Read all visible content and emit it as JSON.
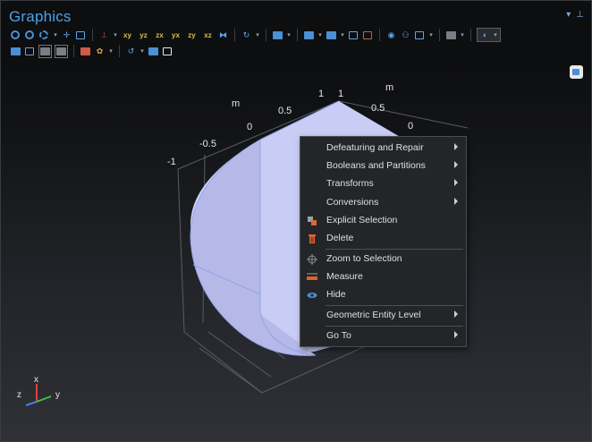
{
  "panel": {
    "title": "Graphics",
    "pin_glyph": "▾",
    "dock_glyph": "⊥"
  },
  "toolbar": {
    "row1_axis_buttons": [
      "xy",
      "yz",
      "zx",
      "yx",
      "zy",
      "xz"
    ],
    "dropdown_glyph": "▾"
  },
  "axes": {
    "unit_left": "m",
    "unit_right": "m",
    "ticks_left": [
      "-1",
      "-0.5",
      "0",
      "0.5",
      "1"
    ],
    "ticks_right": [
      "1",
      "0.5",
      "0"
    ],
    "triad": {
      "x": "x",
      "y": "y",
      "z": "z"
    }
  },
  "context_menu": {
    "items": [
      {
        "label": "Defeaturing and Repair",
        "submenu": true
      },
      {
        "label": "Booleans and Partitions",
        "submenu": true
      },
      {
        "label": "Transforms",
        "submenu": true
      },
      {
        "label": "Conversions",
        "submenu": true
      },
      {
        "label": "Explicit Selection",
        "icon": "explicit-selection-icon"
      },
      {
        "label": "Delete",
        "icon": "delete-icon"
      },
      {
        "label": "Zoom to Selection",
        "icon": "zoom-to-selection-icon"
      },
      {
        "label": "Measure",
        "icon": "measure-icon"
      },
      {
        "label": "Hide",
        "icon": "hide-eye-icon"
      },
      {
        "label": "Geometric Entity Level",
        "submenu": true
      },
      {
        "label": "Go To",
        "submenu": true
      }
    ]
  },
  "colors": {
    "title": "#4aa3e8",
    "geometry_fill": "#c9ccf5",
    "geometry_edge": "#8fa4e8",
    "menu_bg": "#232528"
  }
}
